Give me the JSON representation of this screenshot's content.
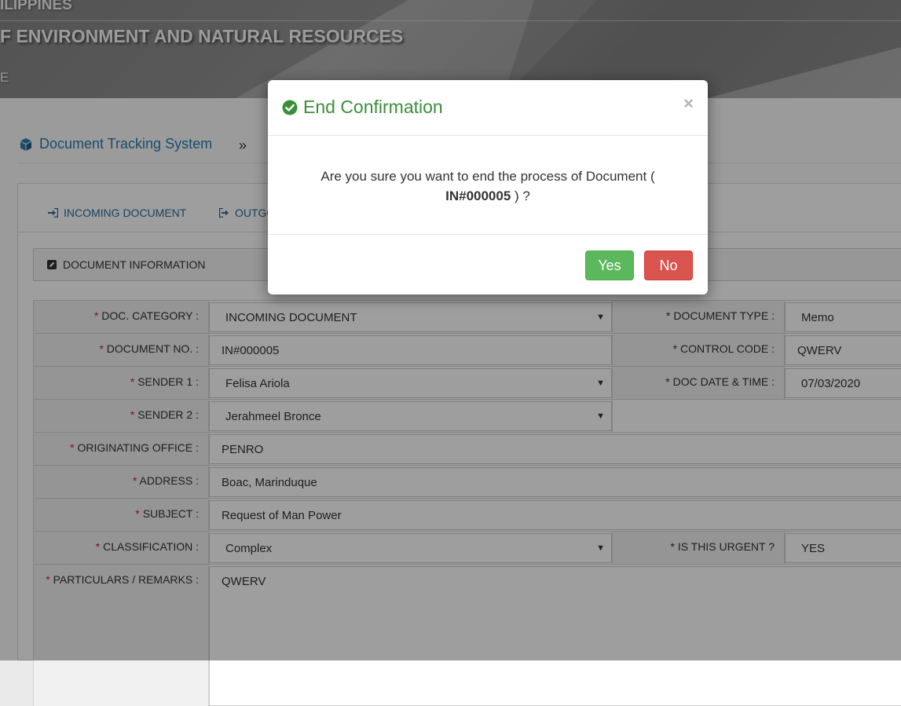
{
  "header": {
    "line1": "ILIPPINES",
    "line2": "F ENVIRONMENT AND NATURAL RESOURCES",
    "line3": "E"
  },
  "breadcrumb": {
    "app_link": "Document Tracking System",
    "separator": "»"
  },
  "tabs": {
    "incoming": "INCOMING DOCUMENT",
    "outgoing": "OUTGO"
  },
  "section": {
    "title": "DOCUMENT INFORMATION"
  },
  "form": {
    "doc_category_label": "DOC. CATEGORY :",
    "doc_category_value": "INCOMING DOCUMENT",
    "document_type_label": "DOCUMENT TYPE :",
    "document_type_value": "Memo",
    "document_no_label": "DOCUMENT NO. :",
    "document_no_value": "IN#000005",
    "control_code_label": "CONTROL CODE :",
    "control_code_value": "QWERV",
    "sender1_label": "SENDER 1 :",
    "sender1_value": "Felisa Ariola",
    "doc_date_label": "DOC DATE & TIME :",
    "doc_date_value": "07/03/2020",
    "sender2_label": "SENDER 2 :",
    "sender2_value": "Jerahmeel Bronce",
    "originating_office_label": "ORIGINATING OFFICE :",
    "originating_office_value": "PENRO",
    "address_label": "ADDRESS :",
    "address_value": "Boac, Marinduque",
    "subject_label": "SUBJECT :",
    "subject_value": "Request of Man Power",
    "classification_label": "CLASSIFICATION :",
    "classification_value": "Complex",
    "urgent_label": "IS THIS URGENT ?",
    "urgent_value": "YES",
    "remarks_label": "PARTICULARS / REMARKS :",
    "remarks_value": "QWERV"
  },
  "modal": {
    "title": "End Confirmation",
    "close": "×",
    "message_prefix": "Are you sure you want to end the process of Document (",
    "doc_no": "IN#000005",
    "message_suffix": ") ?",
    "yes_label": "Yes",
    "no_label": "No"
  },
  "colors": {
    "title_green": "#3a8f3a",
    "yes_button": "#5cb85c",
    "no_button": "#d9534f",
    "link_blue": "#2a7cb0",
    "required_red": "#d42020"
  }
}
